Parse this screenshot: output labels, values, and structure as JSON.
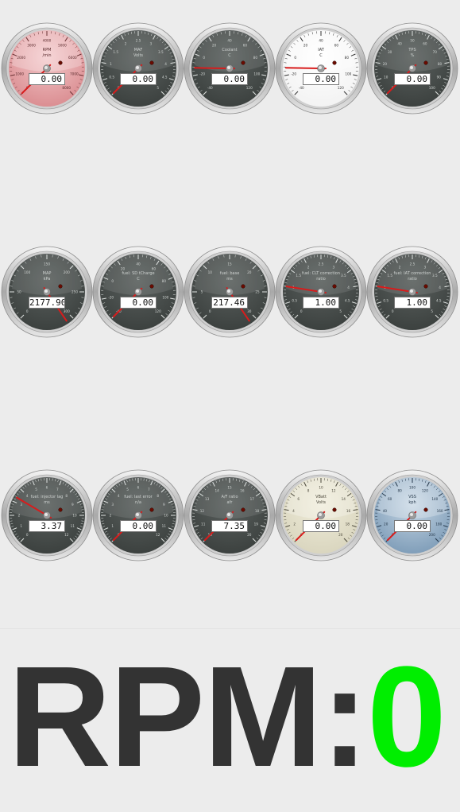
{
  "gauges": [
    {
      "title": "RPM",
      "unit": "/min",
      "value": "0.00",
      "face": "red",
      "ticks": [
        "0",
        "1000",
        "2000",
        "3000",
        "4000",
        "5000",
        "6000",
        "7000",
        "8000"
      ],
      "frac": 0.0
    },
    {
      "title": "MAF",
      "unit": "Volts",
      "value": "0.00",
      "face": "dark",
      "ticks": [
        "0",
        "0.5",
        "1",
        "1.5",
        "2",
        "2.5",
        "3",
        "3.5",
        "4",
        "4.5",
        "5"
      ],
      "frac": 0.0
    },
    {
      "title": "Coolant",
      "unit": "C",
      "value": "0.00",
      "face": "dark",
      "ticks": [
        "-40",
        "-20",
        "0",
        "20",
        "40",
        "60",
        "80",
        "100",
        "120"
      ],
      "frac": 0.17
    },
    {
      "title": "IAT",
      "unit": "C",
      "value": "0.00",
      "face": "white",
      "ticks": [
        "-40",
        "-20",
        "0",
        "20",
        "40",
        "60",
        "80",
        "100",
        "120"
      ],
      "frac": 0.17
    },
    {
      "title": "TPS",
      "unit": "%",
      "value": "0.00",
      "face": "dark",
      "ticks": [
        "0",
        "10",
        "20",
        "30",
        "40",
        "50",
        "60",
        "70",
        "80",
        "90",
        "100"
      ],
      "frac": 0.0
    },
    {
      "title": "MAP",
      "unit": "kPa",
      "value": "2177.90",
      "face": "dark",
      "ticks": [
        "0",
        "50",
        "100",
        "150",
        "200",
        "250",
        "300"
      ],
      "frac": 1.04
    },
    {
      "title": "fuel: SD tCharge",
      "unit": "C",
      "value": "0.00",
      "face": "dark",
      "ticks": [
        "-40",
        "-20",
        "0",
        "20",
        "40",
        "60",
        "80",
        "100",
        "120"
      ],
      "frac": 0.0
    },
    {
      "title": "fuel: base",
      "unit": "ms",
      "value": "217.46",
      "face": "dark",
      "ticks": [
        "0",
        "5",
        "10",
        "15",
        "20",
        "25",
        "30"
      ],
      "frac": 1.04
    },
    {
      "title": "fuel: CLT correction",
      "unit": "ratio",
      "value": "1.00",
      "face": "dark",
      "ticks": [
        "0",
        "0.5",
        "1",
        "1.5",
        "2",
        "2.5",
        "3",
        "3.5",
        "4",
        "4.5",
        "5"
      ],
      "frac": 0.2
    },
    {
      "title": "fuel: IAT correction",
      "unit": "ratio",
      "value": "1.00",
      "face": "dark",
      "ticks": [
        "0",
        "0.5",
        "1",
        "1.5",
        "2",
        "2.5",
        "3",
        "3.5",
        "4",
        "4.5",
        "5"
      ],
      "frac": 0.2
    },
    {
      "title": "fuel: injector lag",
      "unit": "ms",
      "value": "3.37",
      "face": "dark",
      "ticks": [
        "0",
        "1",
        "2",
        "3",
        "4",
        "5",
        "6",
        "7",
        "8",
        "9",
        "10",
        "11",
        "12"
      ],
      "frac": 0.28
    },
    {
      "title": "fuel: last error",
      "unit": "n/a",
      "value": "0.00",
      "face": "dark",
      "ticks": [
        "0",
        "1",
        "2",
        "3",
        "4",
        "5",
        "6",
        "7",
        "8",
        "9",
        "10",
        "11",
        "12"
      ],
      "frac": 0.0
    },
    {
      "title": "A/F ratio",
      "unit": "afr",
      "value": "7.35",
      "face": "dark",
      "ticks": [
        "10",
        "11",
        "12",
        "13",
        "14",
        "15",
        "16",
        "17",
        "18",
        "19",
        "20"
      ],
      "frac": 0.0
    },
    {
      "title": "VBatt",
      "unit": "Volts",
      "value": "0.00",
      "face": "beige",
      "ticks": [
        "0",
        "2",
        "4",
        "6",
        "8",
        "10",
        "12",
        "14",
        "16",
        "18",
        "20"
      ],
      "frac": 0.0
    },
    {
      "title": "VSS",
      "unit": "kph",
      "value": "0.00",
      "face": "blue",
      "ticks": [
        "0",
        "20",
        "40",
        "60",
        "80",
        "100",
        "120",
        "140",
        "160",
        "180",
        "200"
      ],
      "frac": 0.0
    }
  ],
  "rpm": {
    "label": "RPM:",
    "value": "0"
  },
  "colors": {
    "needle": "#d81c1c",
    "rpm_value": "#00ee00",
    "rpm_label": "#333333",
    "led": "#6a0b00"
  }
}
